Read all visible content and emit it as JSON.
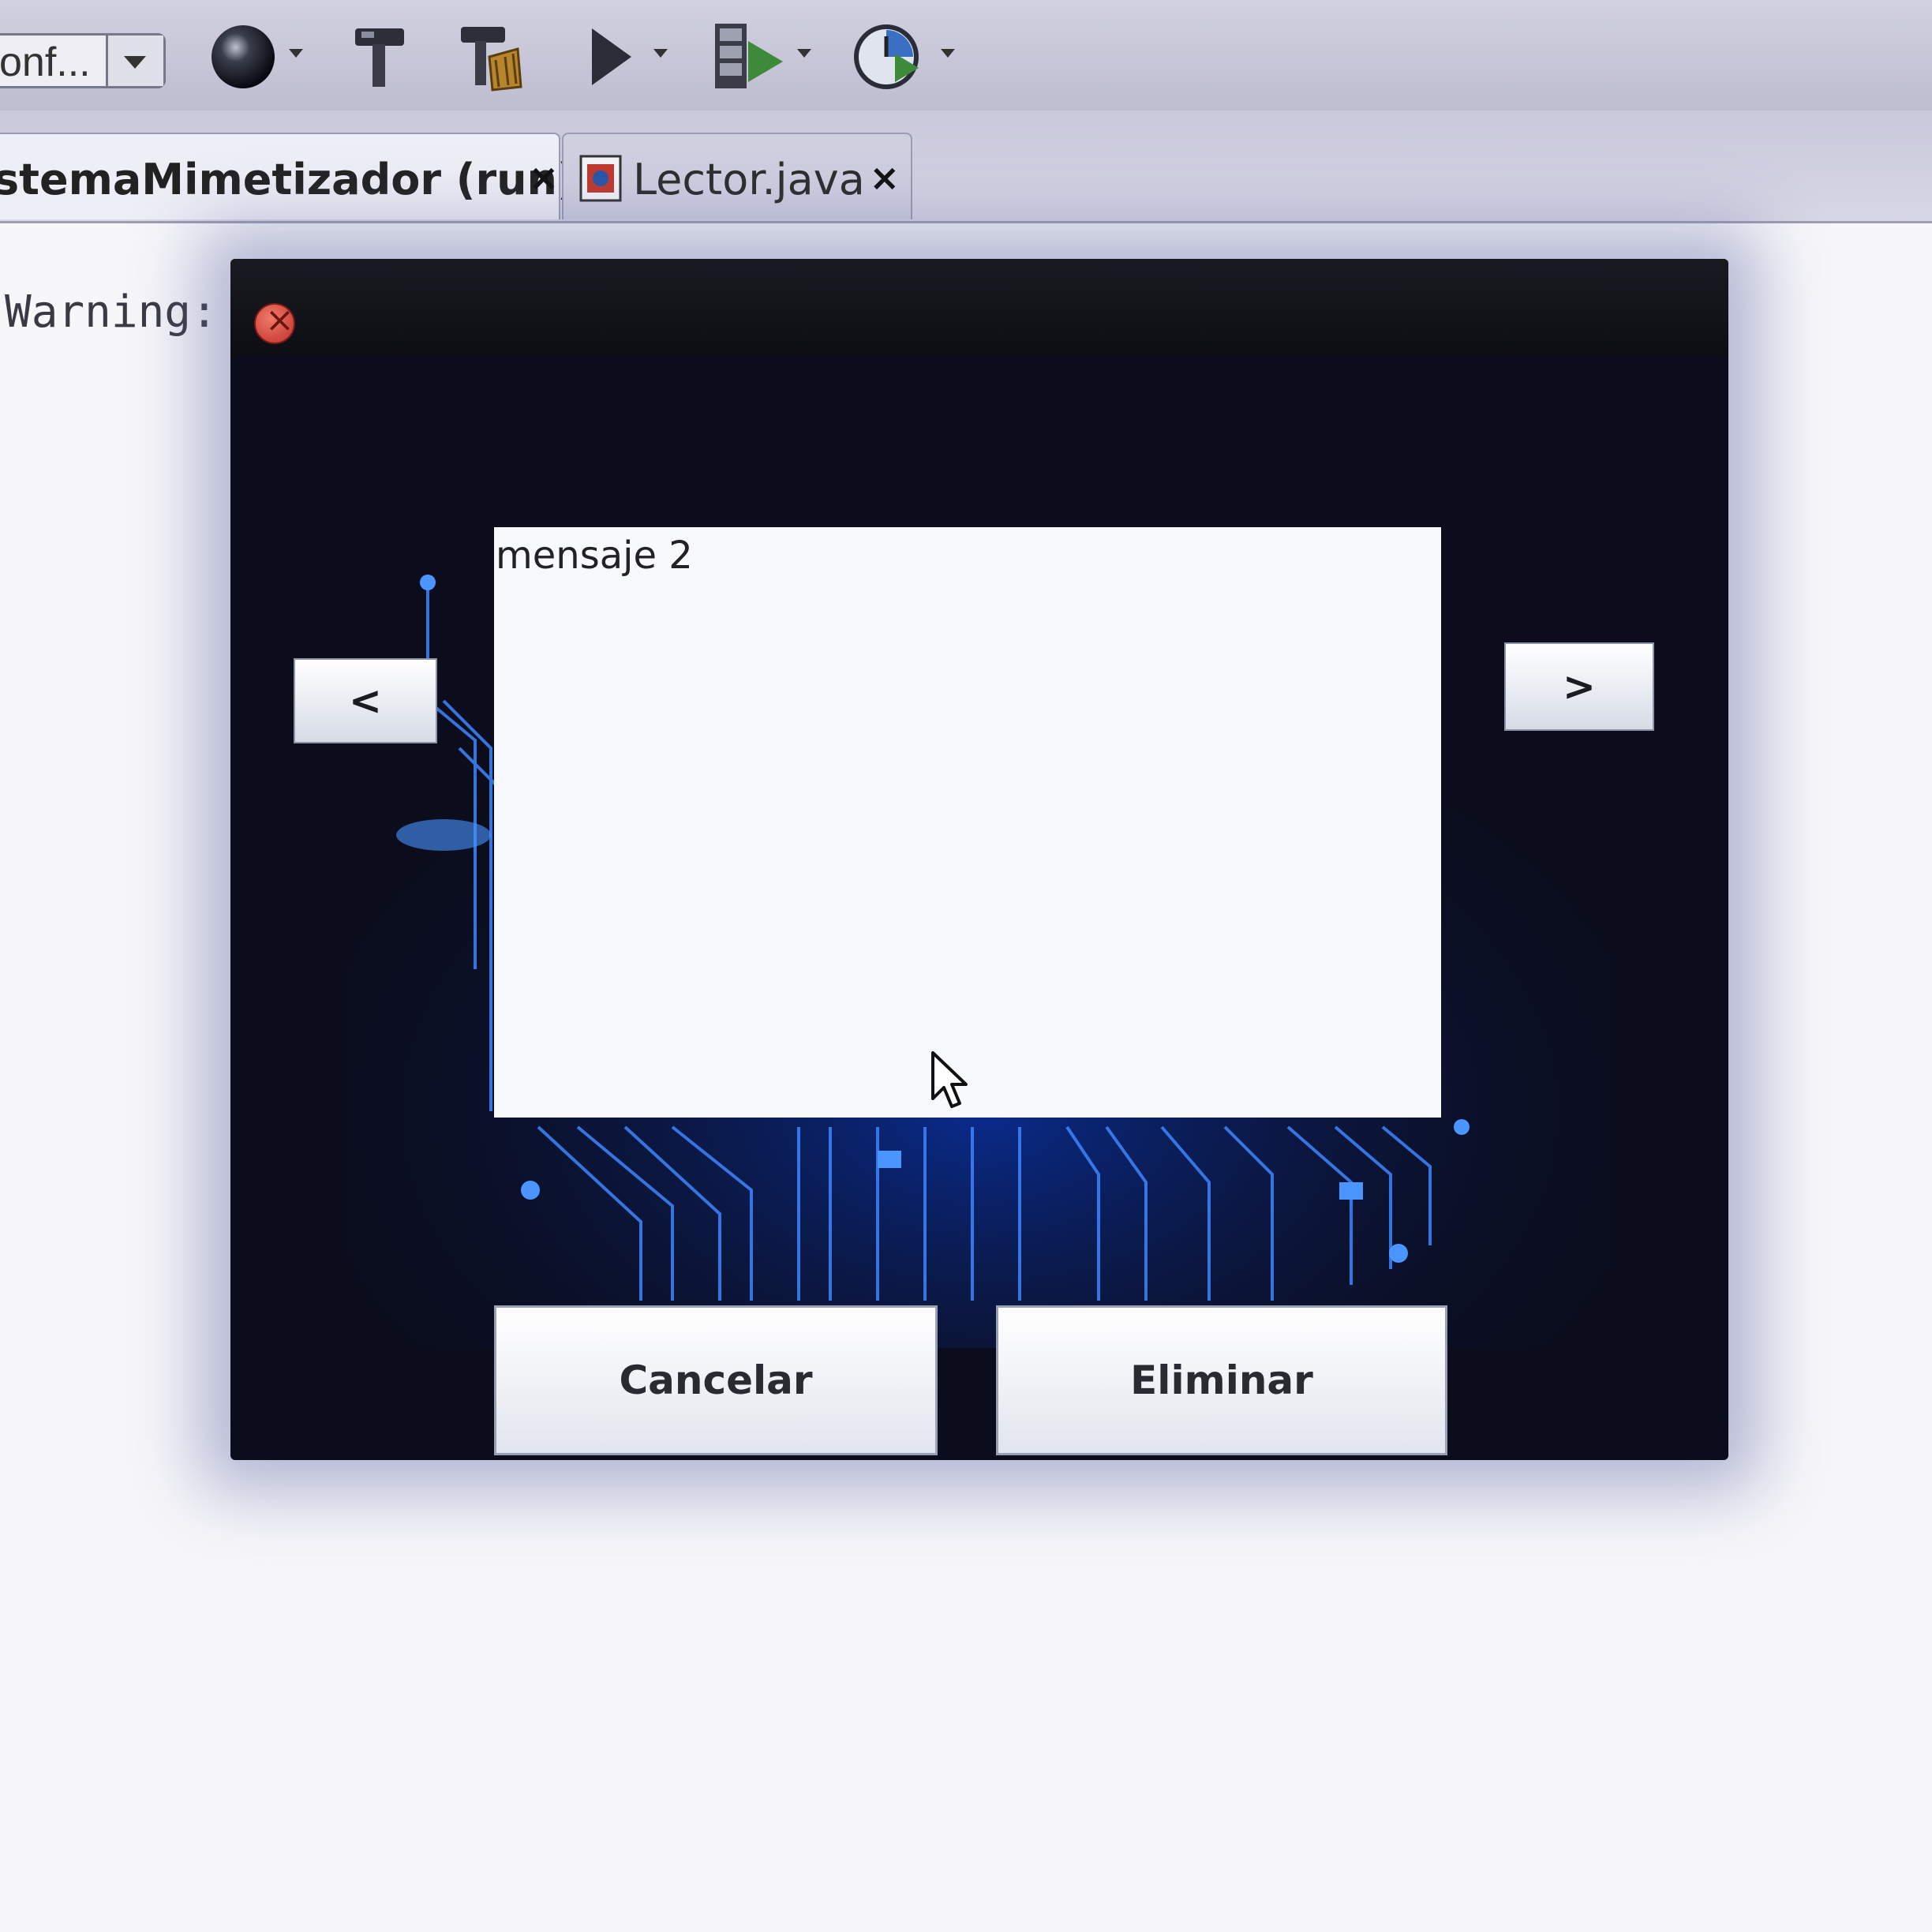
{
  "toolbar": {
    "config_combo_text": "onf...",
    "icons": [
      "globe-icon",
      "build-hammer-icon",
      "clean-build-icon",
      "run-icon",
      "debug-icon",
      "profile-icon"
    ]
  },
  "tabs": [
    {
      "label": "stemaMimetizador (run)",
      "close": "×"
    },
    {
      "label": "Lector.java",
      "close": "×",
      "icon": "java-file-icon"
    }
  ],
  "output": {
    "warning_text": "Warning:"
  },
  "dialog": {
    "message_text": "mensaje 2",
    "prev_label": "<",
    "next_label": ">",
    "cancel_label": "Cancelar",
    "delete_label": "Eliminar"
  },
  "colors": {
    "dialog_background": "#0b0d1c",
    "circuit_glow": "#2f7bff",
    "close_button": "#d8443a"
  }
}
